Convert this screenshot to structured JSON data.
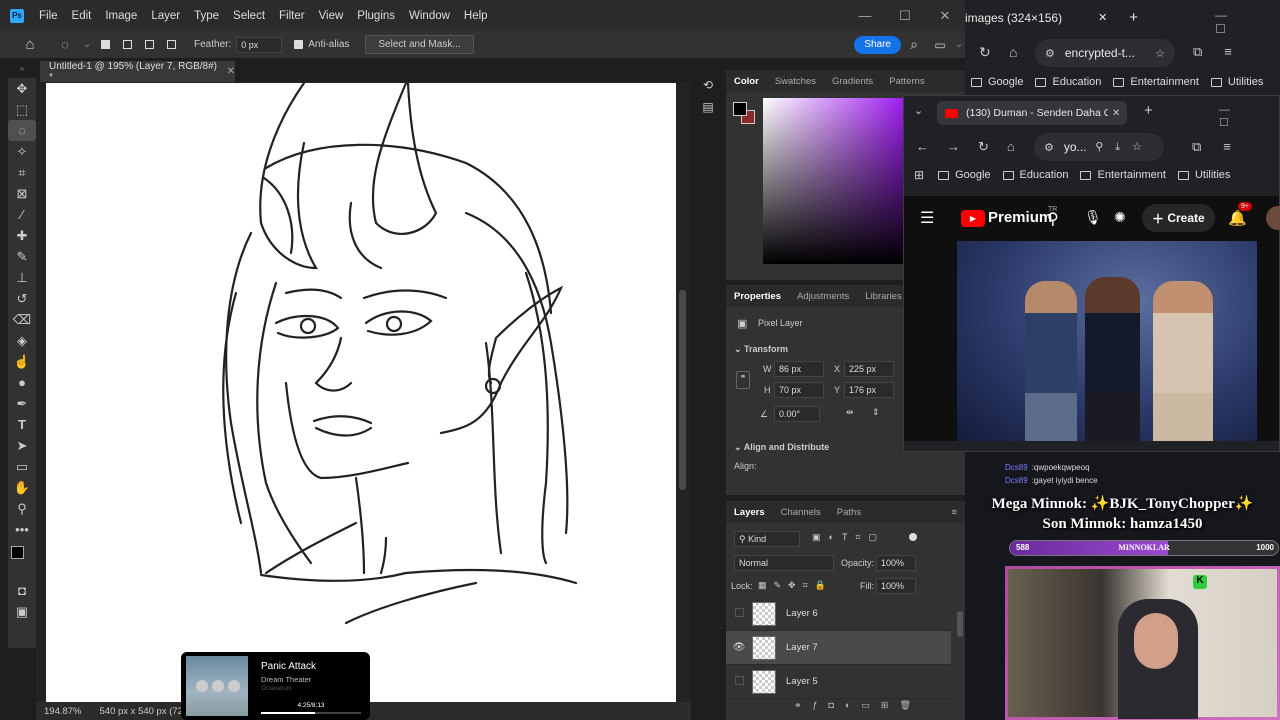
{
  "photoshop": {
    "menu": [
      "File",
      "Edit",
      "Image",
      "Layer",
      "Type",
      "Select",
      "Filter",
      "View",
      "Plugins",
      "Window",
      "Help"
    ],
    "logo": "Ps",
    "options": {
      "feather_label": "Feather:",
      "feather_value": "0 px",
      "antialias": "Anti-alias",
      "select_mask": "Select and Mask...",
      "share": "Share"
    },
    "doc_tab": "Untitled-1 @ 195% (Layer 7, RGB/8#) *",
    "status": {
      "zoom": "194.87%",
      "size": "540 px x 540 px (72"
    },
    "color_panel": {
      "tabs": [
        "Color",
        "Swatches",
        "Gradients",
        "Patterns"
      ],
      "active": "Color",
      "foreground": "#000000",
      "background": "#8b2a2a",
      "hue": "#a020f0"
    },
    "properties": {
      "tabs": [
        "Properties",
        "Adjustments",
        "Libraries"
      ],
      "type": "Pixel Layer",
      "transform_title": "Transform",
      "w_label": "W",
      "w": "86 px",
      "x_label": "X",
      "x": "225 px",
      "h_label": "H",
      "h": "70 px",
      "y_label": "Y",
      "y": "176 px",
      "angle": "0.00°",
      "align_title": "Align and Distribute",
      "align_label": "Align:"
    },
    "layers_panel": {
      "tabs": [
        "Layers",
        "Channels",
        "Paths"
      ],
      "kind": "Kind",
      "blend": "Normal",
      "opacity_label": "Opacity:",
      "opacity": "100%",
      "lock_label": "Lock:",
      "fill_label": "Fill:",
      "fill": "100%",
      "layers": [
        {
          "name": "Layer 6",
          "visible": false
        },
        {
          "name": "Layer 7",
          "visible": true,
          "selected": true
        },
        {
          "name": "Layer 5",
          "visible": false
        }
      ]
    }
  },
  "browser_back": {
    "tab_title": "images (324×156)",
    "address": "encrypted-t...",
    "bookmarks": [
      "Google",
      "Education",
      "Entertainment",
      "Utilities"
    ]
  },
  "browser_front": {
    "tab_title": "(130) Duman - Senden Daha Gü",
    "address": "yo...",
    "bookmarks": [
      "Google",
      "Education",
      "Entertainment",
      "Utilities"
    ],
    "yt_logo": "Premium",
    "yt_sup": "TR",
    "create": "Create",
    "notif": "9+"
  },
  "stream": {
    "chat": [
      {
        "user": "Dcs89",
        "msg": "qwpoekqwpeoq"
      },
      {
        "user": "Dcs89",
        "msg": "gayet iyiydi bence"
      }
    ],
    "mega": "Mega Minnok: ✨BJK_TonyChopper✨",
    "son": "Son Minnok: hamza1450",
    "bar_left": "588",
    "bar_label": "MINNOKLAR",
    "bar_right": "1000",
    "progress": 0.588
  },
  "now_playing": {
    "title": "Panic Attack",
    "artist": "Dream Theater",
    "album": "Octavarium",
    "time": "4:25/8:13",
    "progress": 0.54
  }
}
